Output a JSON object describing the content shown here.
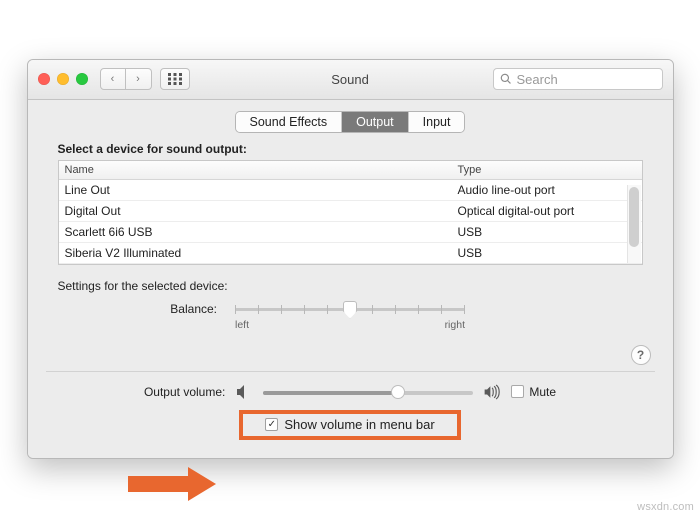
{
  "window": {
    "title": "Sound"
  },
  "search": {
    "placeholder": "Search"
  },
  "tabs": [
    {
      "key": "effects",
      "label": "Sound Effects",
      "selected": false
    },
    {
      "key": "output",
      "label": "Output",
      "selected": true
    },
    {
      "key": "input",
      "label": "Input",
      "selected": false
    }
  ],
  "section": {
    "select_device_label": "Select a device for sound output:",
    "columns": {
      "name": "Name",
      "type": "Type"
    },
    "devices": [
      {
        "name": "Line Out",
        "type": "Audio line-out port"
      },
      {
        "name": "Digital Out",
        "type": "Optical digital-out port"
      },
      {
        "name": "Scarlett 6i6 USB",
        "type": "USB"
      },
      {
        "name": "Siberia V2 Illuminated",
        "type": "USB"
      }
    ],
    "settings_label": "Settings for the selected device:",
    "balance": {
      "label": "Balance:",
      "left_label": "left",
      "right_label": "right",
      "value_percent": 50
    }
  },
  "output_volume": {
    "label": "Output volume:",
    "value_percent": 64,
    "mute_label": "Mute",
    "mute_checked": false
  },
  "menubar": {
    "label": "Show volume in menu bar",
    "checked": true
  },
  "help_label": "?",
  "watermark": "wsxdn.com"
}
